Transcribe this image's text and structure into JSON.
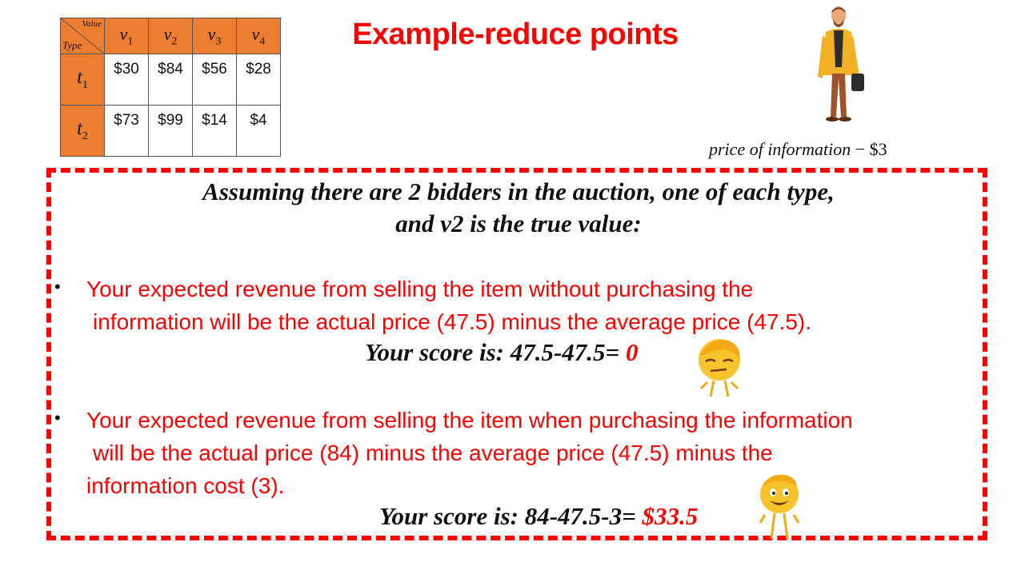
{
  "table": {
    "corner_value": "Value",
    "corner_type": "Type",
    "columns": [
      {
        "base": "v",
        "sub": "1"
      },
      {
        "base": "v",
        "sub": "2"
      },
      {
        "base": "v",
        "sub": "3"
      },
      {
        "base": "v",
        "sub": "4"
      }
    ],
    "rows": [
      {
        "base": "t",
        "sub": "1",
        "cells": [
          "$30",
          "$84",
          "$56",
          "$28"
        ]
      },
      {
        "base": "t",
        "sub": "2",
        "cells": [
          "$73",
          "$99",
          "$14",
          "$4"
        ]
      }
    ]
  },
  "title": "Example-reduce points",
  "price_info": {
    "label": "price of information",
    "sep": " − ",
    "amount": "$3"
  },
  "assumption": {
    "line1": "Assuming there are 2 bidders in the auction, one of each type,",
    "line2": "and v2 is the true value:"
  },
  "bullets": [
    {
      "line1": "Your expected revenue from selling the item without purchasing the",
      "line2": "information will be the actual price (47.5) minus the average price (47.5).",
      "score_label": "Your score is: 47.5-47.5= ",
      "score_value": "0"
    },
    {
      "line1": "Your expected revenue from selling the item when purchasing the information",
      "line2": "will be the actual price (84) minus the average price (47.5) minus the",
      "line3": "information cost (3).",
      "score_label": "Your score is: 84-47.5-3= ",
      "score_value": "$33.5"
    }
  ],
  "bullet_symbol": "•",
  "colors": {
    "accent_red": "#ff0000",
    "header_orange": "#ed7d31"
  },
  "icons": {
    "man": "businessman-illustration",
    "emoji_meh": "unimpressed-emoji-character",
    "emoji_happy": "smiling-emoji-character"
  }
}
